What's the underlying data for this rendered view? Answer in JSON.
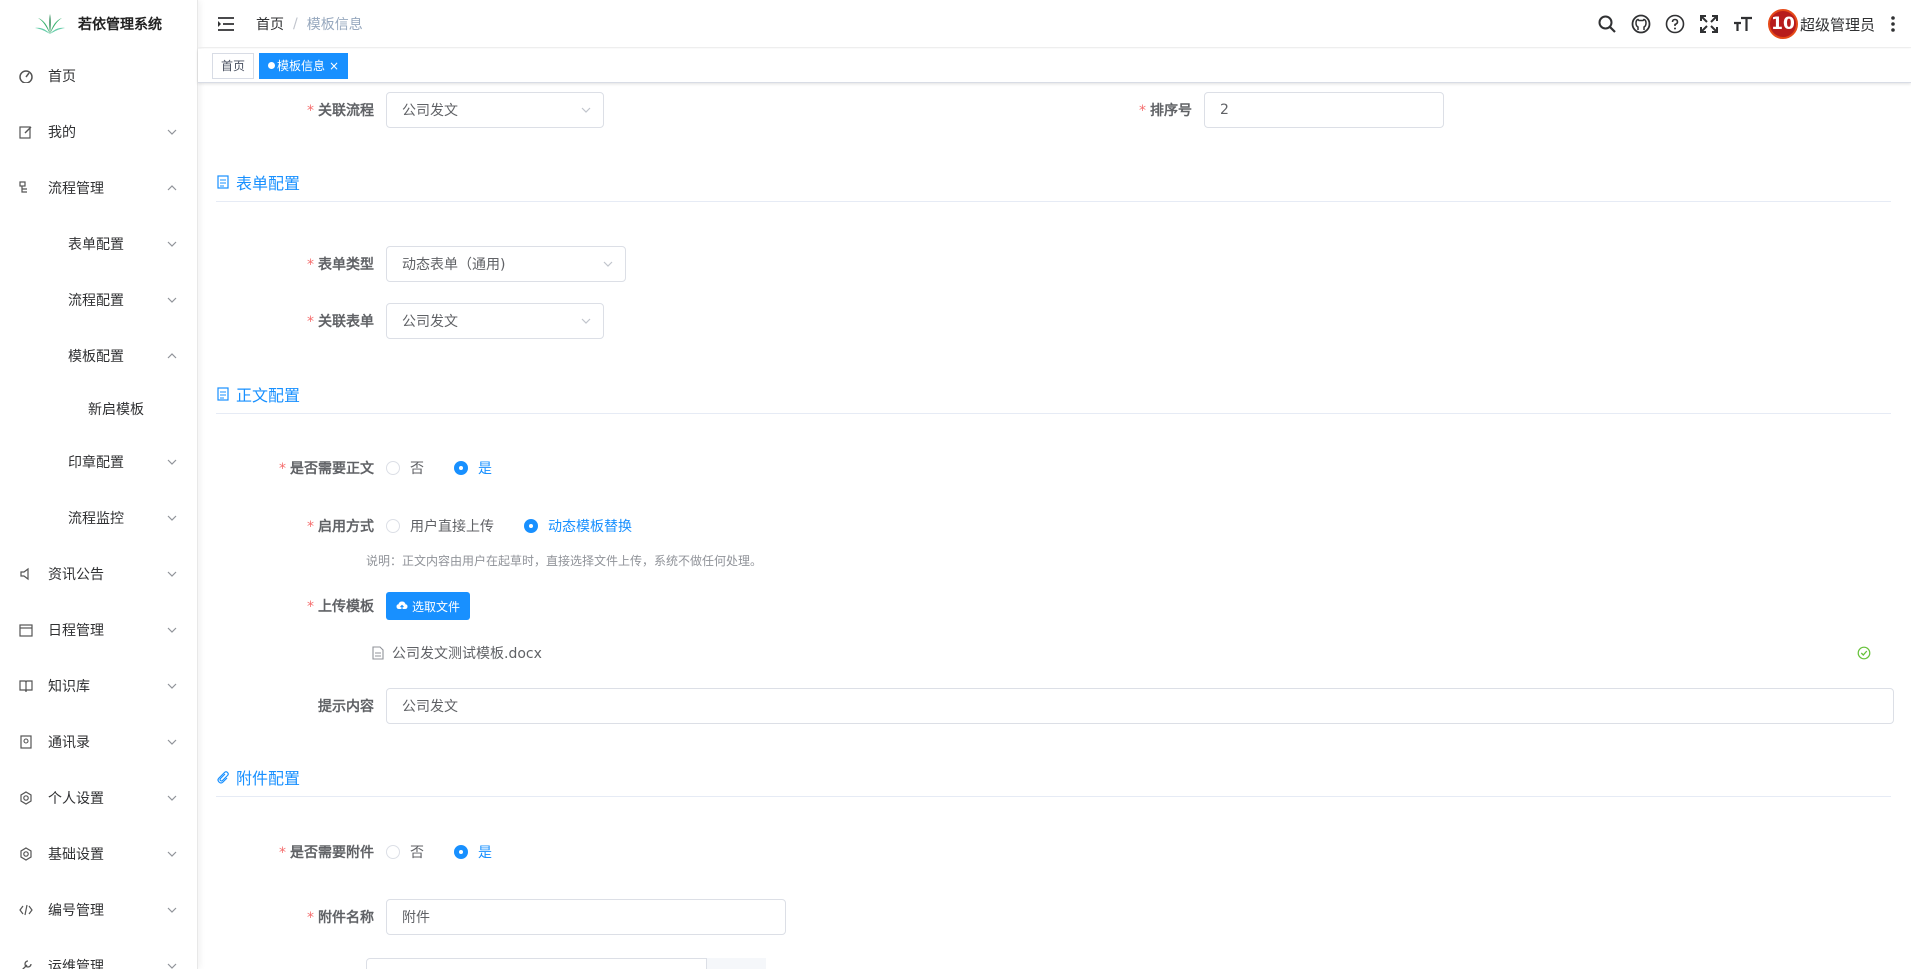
{
  "app": {
    "title": "若依管理系统"
  },
  "sidebar": {
    "items": [
      {
        "label": "首页",
        "icon": "dashboard-icon"
      },
      {
        "label": "我的",
        "icon": "edit-icon"
      },
      {
        "label": "流程管理",
        "icon": "tree-icon"
      },
      {
        "label": "表单配置"
      },
      {
        "label": "流程配置"
      },
      {
        "label": "模板配置"
      },
      {
        "label": "新启模板"
      },
      {
        "label": "印章配置"
      },
      {
        "label": "流程监控"
      },
      {
        "label": "资讯公告",
        "icon": "speaker-icon"
      },
      {
        "label": "日程管理",
        "icon": "calendar-icon"
      },
      {
        "label": "知识库",
        "icon": "book-icon"
      },
      {
        "label": "通讯录",
        "icon": "contact-icon"
      },
      {
        "label": "个人设置",
        "icon": "settings-icon"
      },
      {
        "label": "基础设置",
        "icon": "settings-icon"
      },
      {
        "label": "编号管理",
        "icon": "code-icon"
      },
      {
        "label": "运维管理",
        "icon": "tools-icon"
      }
    ]
  },
  "header": {
    "breadcrumb": [
      "首页",
      "模板信息"
    ],
    "breadcrumb_sep": "/",
    "user": {
      "avatar_text": "10",
      "name": "超级管理员"
    }
  },
  "tags": {
    "home": "首页",
    "active": "模板信息",
    "close": "×"
  },
  "form": {
    "flow": {
      "label": "关联流程",
      "value": "公司发文"
    },
    "sort": {
      "label": "排序号",
      "value": "2"
    },
    "section_form": "表单配置",
    "form_type": {
      "label": "表单类型",
      "value": "动态表单（通用)"
    },
    "form_link": {
      "label": "关联表单",
      "value": "公司发文"
    },
    "section_body": "正文配置",
    "need_body": {
      "label": "是否需要正文",
      "options": [
        "否",
        "是"
      ],
      "selected": "是"
    },
    "enable_mode": {
      "label": "启用方式",
      "options": [
        "用户直接上传",
        "动态模板替换"
      ],
      "selected": "动态模板替换",
      "hint": "说明：正文内容由用户在起草时，直接选择文件上传，系统不做任何处理。"
    },
    "upload": {
      "label": "上传模板",
      "button": "选取文件",
      "file": "公司发文测试模板.docx"
    },
    "prompt": {
      "label": "提示内容",
      "value": "公司发文"
    },
    "section_attach": "附件配置",
    "need_attach": {
      "label": "是否需要附件",
      "options": [
        "否",
        "是"
      ],
      "selected": "是"
    },
    "attach_name": {
      "label": "附件名称",
      "value": "附件"
    }
  },
  "colors": {
    "primary": "#1890ff",
    "required": "#f56c6c",
    "success": "#67c23a"
  }
}
